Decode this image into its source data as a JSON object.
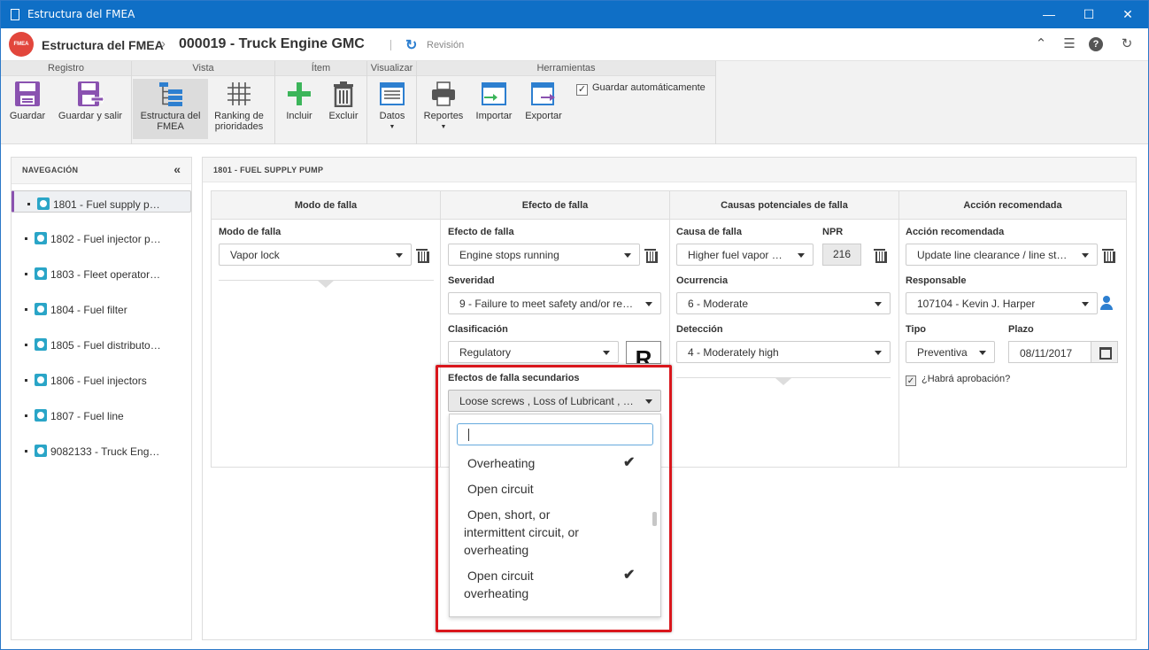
{
  "window": {
    "title": "Estructura del FMEA",
    "controls": [
      "—",
      "☐",
      "✕"
    ]
  },
  "header": {
    "logo_text": "FMEA",
    "crumb_module": "Estructura del FMEA",
    "crumb_separator": "›",
    "record_title": "000019 - Truck Engine GMC",
    "revision_label": "Revisión",
    "revision_icon": "↻",
    "icons": [
      "collapse-up-icon",
      "list-icon",
      "help-icon",
      "refresh-icon"
    ],
    "icon_glyphs": [
      "⌃",
      "☰",
      "?",
      "↻"
    ]
  },
  "ribbon": {
    "groups": {
      "registro": "Registro",
      "vista": "Vista",
      "item": "Ítem",
      "visualizar": "Visualizar",
      "herramientas": "Herramientas"
    },
    "buttons": {
      "guardar": "Guardar",
      "guardar_salir": "Guardar y salir",
      "estructura_line1": "Estructura del",
      "estructura_line2": "FMEA",
      "ranking_line1": "Ranking de",
      "ranking_line2": "prioridades",
      "incluir": "Incluir",
      "excluir": "Excluir",
      "datos": "Datos",
      "reportes": "Reportes",
      "importar": "Importar",
      "exportar": "Exportar"
    },
    "autosave_label": "Guardar automáticamente",
    "autosave_checked": true
  },
  "navigation": {
    "title": "NAVEGACIÓN",
    "collapse_glyph": "«",
    "items": [
      {
        "label": "1801 - Fuel supply p…"
      },
      {
        "label": "1802 - Fuel injector p…"
      },
      {
        "label": "1803 - Fleet operator…"
      },
      {
        "label": "1804 - Fuel filter"
      },
      {
        "label": "1805 - Fuel distributo…"
      },
      {
        "label": "1806 - Fuel injectors"
      },
      {
        "label": "1807 - Fuel line"
      },
      {
        "label": "9082133 - Truck Eng…"
      }
    ],
    "selected_index": 0
  },
  "main": {
    "title": "1801 - FUEL SUPPLY PUMP",
    "columns": {
      "modo": "Modo de falla",
      "efecto": "Efecto de falla",
      "causas": "Causas potenciales de falla",
      "accion": "Acción recomendada"
    },
    "modo": {
      "label": "Modo de falla",
      "value": "Vapor lock"
    },
    "efecto": {
      "label": "Efecto de falla",
      "value": "Engine stops running",
      "severidad_label": "Severidad",
      "severidad_value": "9 - Failure to meet safety and/or re…",
      "clasificacion_label": "Clasificación",
      "clasificacion_value": "Regulatory",
      "clasificacion_symbol": "R",
      "secundarios_label": "Efectos de falla secundarios",
      "secundarios_value": "Loose screws , Loss of Lubricant , …"
    },
    "causas": {
      "label": "Causa de falla",
      "value": "Higher fuel vapor …",
      "npr_label": "NPR",
      "npr_value": "216",
      "ocurrencia_label": "Ocurrencia",
      "ocurrencia_value": "6 - Moderate",
      "deteccion_label": "Detección",
      "deteccion_value": "4 - Moderately high"
    },
    "accion": {
      "label": "Acción recomendada",
      "value": "Update line clearance / line st…",
      "responsable_label": "Responsable",
      "responsable_value": "107104 - Kevin J. Harper",
      "tipo_label": "Tipo",
      "tipo_value": "Preventiva",
      "plazo_label": "Plazo",
      "plazo_value": "08/11/2017",
      "aprobacion_label": "¿Habrá aprobación?",
      "aprobacion_checked": true
    }
  },
  "dropdown": {
    "search_value": "",
    "options": [
      {
        "line1": "Overheating",
        "checked": true
      },
      {
        "line1": "Open circuit",
        "checked": false
      },
      {
        "line1": "Open, short, or",
        "line2": "intermittent circuit, or",
        "line3": "overheating",
        "checked": false
      },
      {
        "line1": "Open circuit",
        "line2": "overheating",
        "checked": true
      }
    ],
    "check_glyph": "✔"
  },
  "colors": {
    "titlebar": "#0f6fc6",
    "accent": "#2d7fd0",
    "nav_selected_bar": "#8a52b0",
    "highlight": "#d9161c",
    "logo": "#e2463c"
  }
}
